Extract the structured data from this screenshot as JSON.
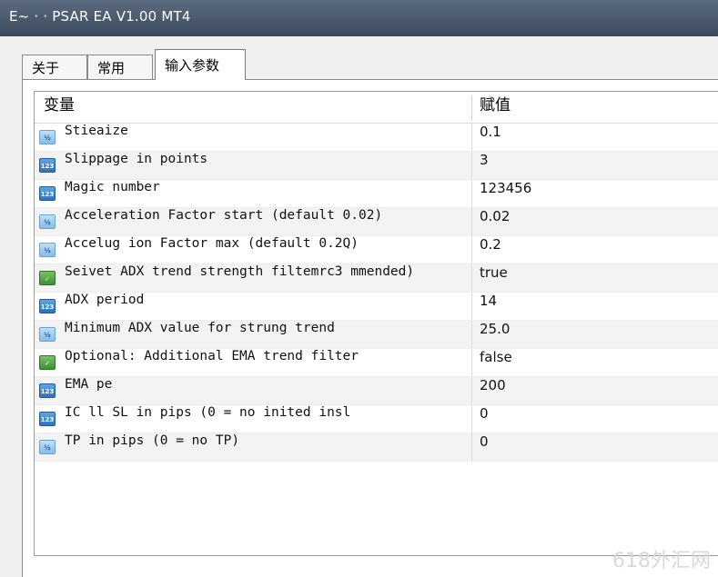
{
  "window": {
    "title": "E~ · · PSAR EA V1.00 MT4"
  },
  "tabs": [
    {
      "label": "关于"
    },
    {
      "label": "常用"
    },
    {
      "label": "输入参数"
    }
  ],
  "table": {
    "headers": {
      "variable": "变量",
      "value": "赋值"
    },
    "rows": [
      {
        "icon": "double-value-icon",
        "name": "Stieaize",
        "value": "0.1"
      },
      {
        "icon": "integer-icon",
        "name": "Slippage in points",
        "value": "3"
      },
      {
        "icon": "integer-icon",
        "name": "Magic number",
        "value": "123456"
      },
      {
        "icon": "double-value-icon",
        "name": "Acceleration Factor start (default 0.02)",
        "value": "0.02"
      },
      {
        "icon": "double-value-icon",
        "name": "Accelug ion Factor max (default 0.2Q)",
        "value": "0.2"
      },
      {
        "icon": "boolean-icon",
        "name": "Seivet ADX trend strength filtemrc3 mmended)",
        "value": "true"
      },
      {
        "icon": "integer-icon",
        "name": "ADX period",
        "value": "14"
      },
      {
        "icon": "double-value-icon",
        "name": "Minimum ADX value for strung trend",
        "value": "25.0"
      },
      {
        "icon": "boolean-icon",
        "name": "Optional: Additional EMA trend filter",
        "value": "false"
      },
      {
        "icon": "integer-icon",
        "name": "EMA pe",
        "value": "200"
      },
      {
        "icon": "integer-icon",
        "name": "IC  ll SL in pips (0 = no inited insl",
        "value": "0"
      },
      {
        "icon": "double-value-icon",
        "name": "TP in pips (0 = no TP)",
        "value": "0"
      }
    ]
  },
  "watermark": "618外汇网"
}
